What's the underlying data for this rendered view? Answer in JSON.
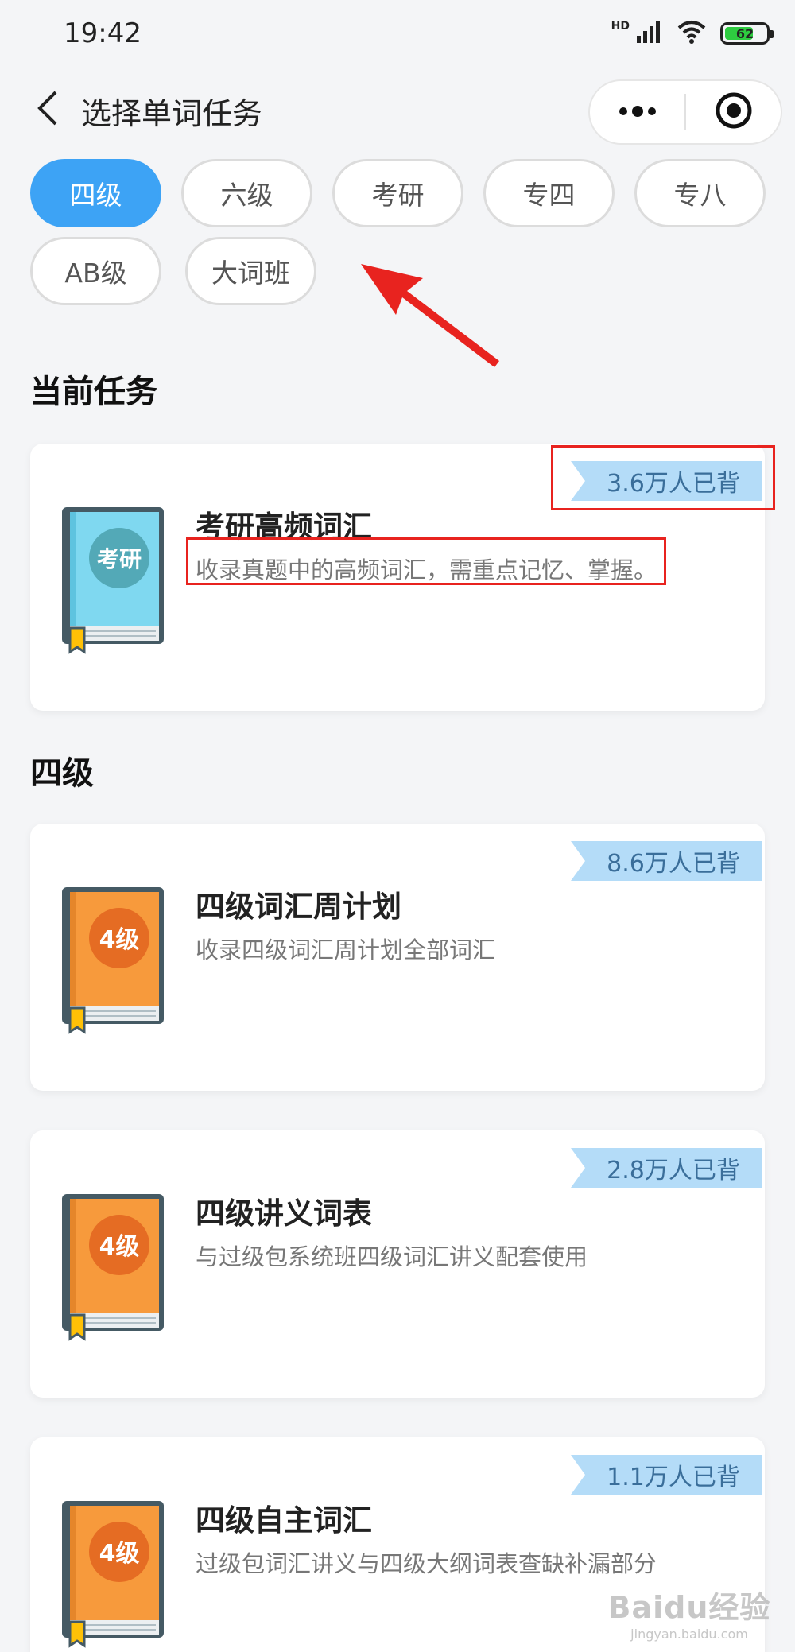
{
  "status_bar": {
    "time": "19:42",
    "network": "HD",
    "battery_level": "62",
    "icons": [
      "signal-icon",
      "wifi-icon",
      "battery-icon"
    ]
  },
  "nav": {
    "title": "选择单词任务",
    "back_icon": "chevron-left-icon",
    "more_icon": "more-dots-icon",
    "close_icon": "target-circle-icon"
  },
  "tabs": [
    {
      "label": "四级",
      "active": true
    },
    {
      "label": "六级",
      "active": false
    },
    {
      "label": "考研",
      "active": false
    },
    {
      "label": "专四",
      "active": false
    },
    {
      "label": "专八",
      "active": false
    },
    {
      "label": "AB级",
      "active": false
    },
    {
      "label": "大词班",
      "active": false
    }
  ],
  "current_section": {
    "title": "当前任务",
    "card": {
      "book_label": "考研",
      "title": "考研高频词汇",
      "desc": "收录真题中的高频词汇，需重点记忆、掌握。",
      "badge": "3.6万人已背"
    }
  },
  "cet4_section": {
    "title": "四级",
    "cards": [
      {
        "book_label": "4级",
        "title": "四级词汇周计划",
        "desc": "收录四级词汇周计划全部词汇",
        "badge": "8.6万人已背"
      },
      {
        "book_label": "4级",
        "title": "四级讲义词表",
        "desc": "与过级包系统班四级词汇讲义配套使用",
        "badge": "2.8万人已背"
      },
      {
        "book_label": "4级",
        "title": "四级自主词汇",
        "desc": "过级包词汇讲义与四级大纲词表查缺补漏部分",
        "badge": "1.1万人已背"
      }
    ]
  },
  "colors": {
    "accent": "#3da3f5",
    "badge_bg": "#b4dcf8",
    "book_teal": "#7fd8f0",
    "book_orange": "#f79a3c",
    "annotation_red": "#e8231f"
  },
  "watermark": {
    "main": "Baidu经验",
    "sub": "jingyan.baidu.com"
  }
}
